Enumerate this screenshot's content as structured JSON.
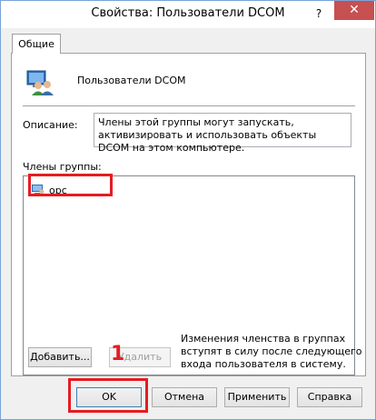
{
  "window": {
    "title": "Свойства: Пользователи DCOM",
    "help_label": "?",
    "close_label": "✕"
  },
  "tabs": [
    {
      "label": "Общие"
    }
  ],
  "group": {
    "name": "Пользователи DCOM",
    "icon": "users-group-icon"
  },
  "description": {
    "label": "Описание:",
    "value": "Члены этой группы могут запускать, активизировать и использовать объекты DCOM на этом компьютере."
  },
  "members": {
    "label": "Члены группы:",
    "items": [
      {
        "name": "opc",
        "icon": "computer-user-icon"
      }
    ]
  },
  "buttons": {
    "add": "Добавить...",
    "remove": "Удалить",
    "ok": "OK",
    "cancel": "Отмена",
    "apply": "Применить",
    "help": "Справка"
  },
  "note": "Изменения членства в группах вступят в силу после следующего входа пользователя в систему.",
  "annotation": {
    "number": "1",
    "color": "#e51c23"
  },
  "colors": {
    "accent": "#3c7fb1",
    "close": "#c75050"
  }
}
